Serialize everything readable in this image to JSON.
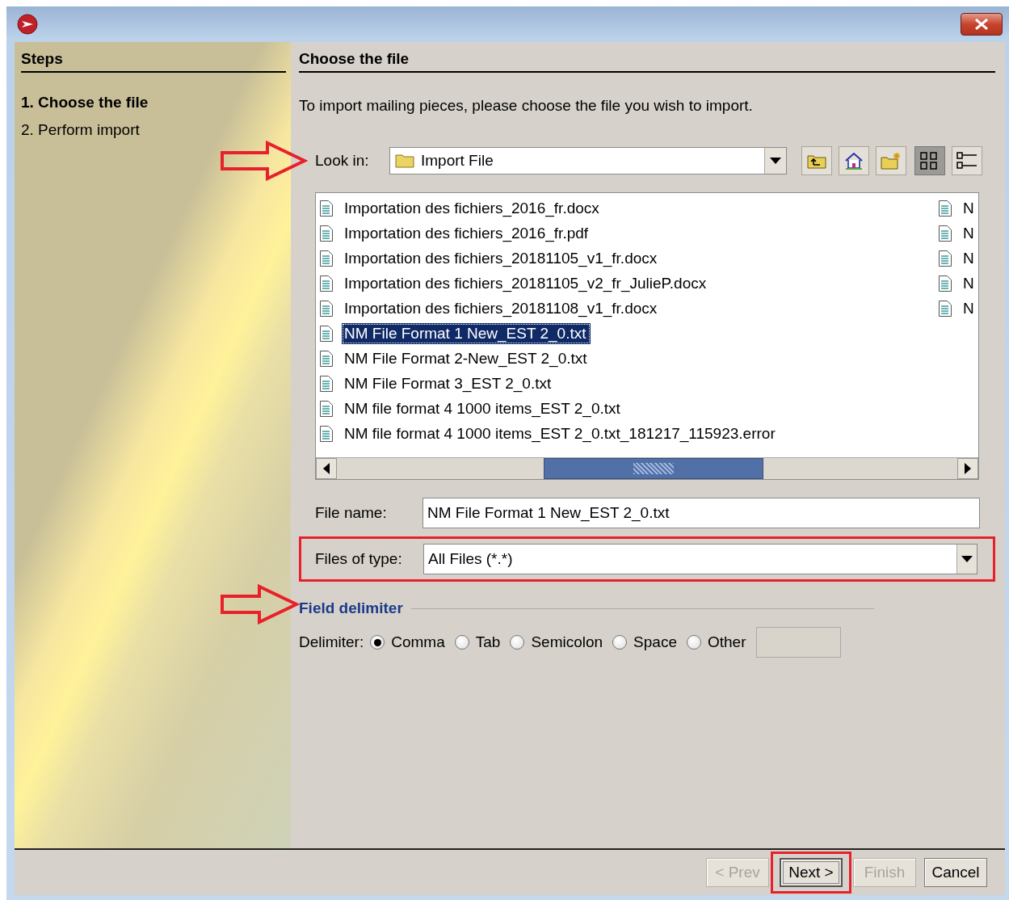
{
  "steps": {
    "title": "Steps",
    "items": [
      {
        "label": "1. Choose the file",
        "selected": true
      },
      {
        "label": "2. Perform import",
        "selected": false
      }
    ]
  },
  "page": {
    "title": "Choose the file",
    "intro": "To import mailing pieces, please choose the file you wish to import."
  },
  "look_in": {
    "label": "Look in:",
    "value": "Import File"
  },
  "toolbar": [
    {
      "kind": "up",
      "selected": false
    },
    {
      "kind": "home",
      "selected": false
    },
    {
      "kind": "new-folder",
      "selected": false
    },
    {
      "kind": "list",
      "selected": true
    },
    {
      "kind": "details",
      "selected": false
    }
  ],
  "file_list": {
    "items": [
      {
        "name": "Importation des fichiers_2016_fr.docx",
        "selected": false
      },
      {
        "name": "Importation des fichiers_2016_fr.pdf",
        "selected": false
      },
      {
        "name": "Importation des fichiers_20181105_v1_fr.docx",
        "selected": false
      },
      {
        "name": "Importation des fichiers_20181105_v2_fr_JulieP.docx",
        "selected": false
      },
      {
        "name": "Importation des fichiers_20181108_v1_fr.docx",
        "selected": false
      },
      {
        "name": "NM File Format 1 New_EST 2_0.txt",
        "selected": true
      },
      {
        "name": "NM File Format 2-New_EST 2_0.txt",
        "selected": false
      },
      {
        "name": "NM File Format 3_EST 2_0.txt",
        "selected": false
      },
      {
        "name": "NM file format 4 1000 items_EST 2_0.txt",
        "selected": false
      },
      {
        "name": "NM file format 4 1000 items_EST 2_0.txt_181217_115923.error",
        "selected": false
      }
    ],
    "column_2": [
      {
        "name": "N"
      },
      {
        "name": "N"
      },
      {
        "name": "N"
      },
      {
        "name": "N"
      },
      {
        "name": "N"
      }
    ]
  },
  "file_name": {
    "label": "File name:",
    "value": "NM File Format 1 New_EST 2_0.txt"
  },
  "file_type": {
    "label": "Files of type:",
    "value": "All Files (*.*)"
  },
  "delimiter": {
    "title": "Field delimiter",
    "label": "Delimiter:",
    "options": [
      {
        "label": "Comma",
        "selected": true
      },
      {
        "label": "Tab",
        "selected": false
      },
      {
        "label": "Semicolon",
        "selected": false
      },
      {
        "label": "Space",
        "selected": false
      },
      {
        "label": "Other",
        "selected": false
      }
    ]
  },
  "buttons": [
    {
      "label": "< Prev",
      "disabled": true,
      "default": false
    },
    {
      "label": "Next >",
      "disabled": false,
      "default": true
    },
    {
      "label": "Finish",
      "disabled": true,
      "default": false
    },
    {
      "label": "Cancel",
      "disabled": false,
      "default": false
    }
  ]
}
